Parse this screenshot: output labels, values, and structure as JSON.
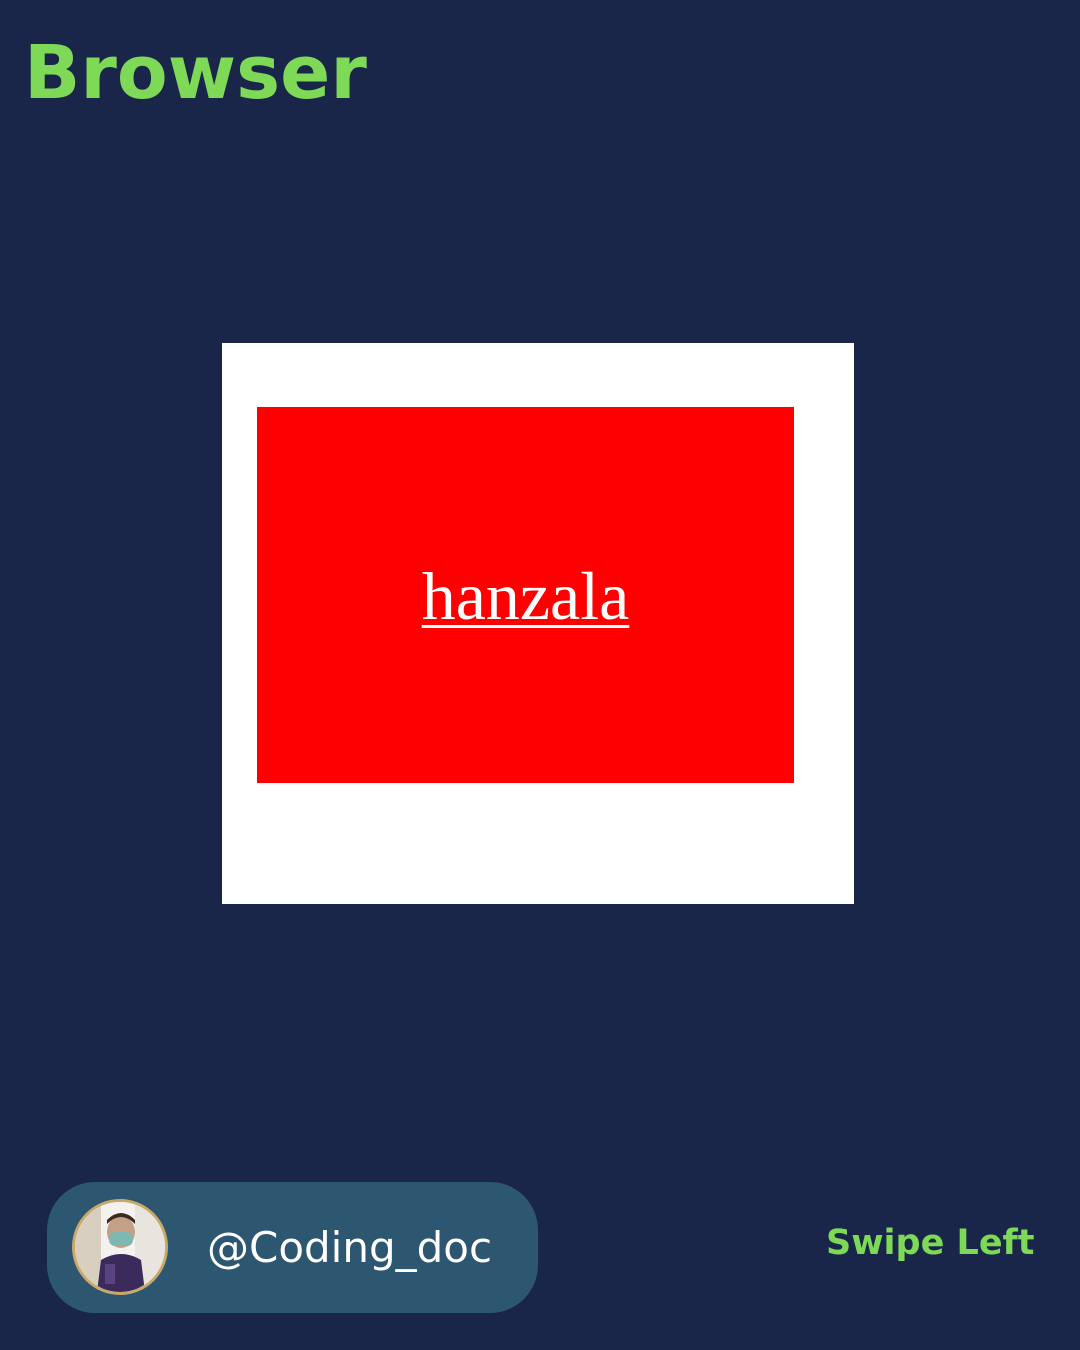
{
  "header": {
    "title": "Browser"
  },
  "preview": {
    "link_text": "hanzala",
    "box_color": "#ff0000",
    "frame_color": "#ffffff"
  },
  "footer": {
    "handle": "@Coding_doc",
    "swipe_label": "Swipe Left",
    "avatar_icon": "profile-photo"
  },
  "colors": {
    "background": "#1a2649",
    "accent": "#7ed957",
    "pill": "#2d5670"
  }
}
